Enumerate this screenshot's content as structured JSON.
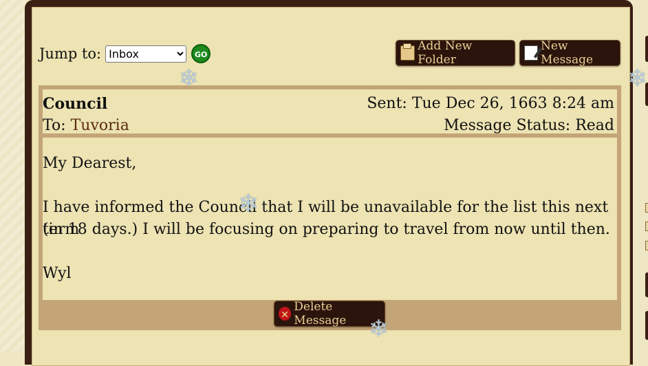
{
  "jump": {
    "label": "Jump to:",
    "selected": "Inbox",
    "go_label": "GO"
  },
  "toolbar": {
    "add_folder_label": "Add New Folder",
    "new_message_label": "New Message"
  },
  "message": {
    "from": "Council",
    "to_label": "To:",
    "to_name": "Tuvoria",
    "sent": "Sent: Tue Dec 26, 1663 8:24 am",
    "status": "Message Status: Read",
    "greeting": "My Dearest,",
    "line1": "I have informed the Council that I will be unavailable for the list this next term",
    "line2": "(in 18 days.) I will be focusing on preparing to travel from now until then.",
    "signature": "Wyl"
  },
  "actions": {
    "delete_label": "Delete Message"
  },
  "decor": {
    "snowflake": "❄"
  }
}
